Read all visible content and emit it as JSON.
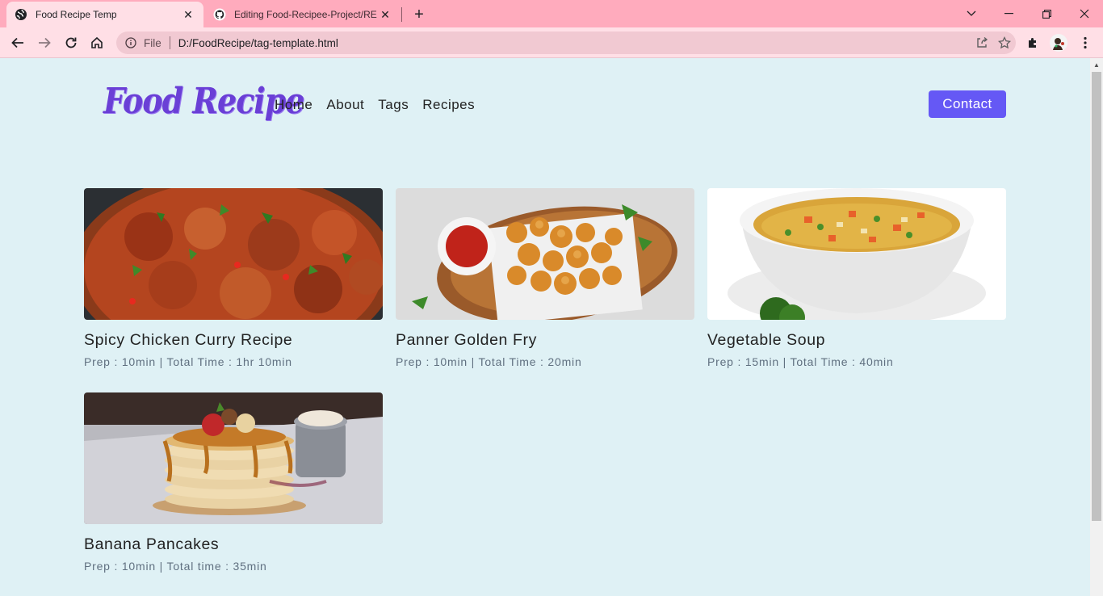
{
  "browser": {
    "tabs": [
      {
        "title": "Food Recipe Temp"
      },
      {
        "title": "Editing Food-Recipee-Project/RE"
      }
    ],
    "address": {
      "scheme": "File",
      "url": "D:/FoodRecipe/tag-template.html"
    }
  },
  "site": {
    "logo_text": "Food Recipe",
    "nav": [
      {
        "label": "Home"
      },
      {
        "label": "About"
      },
      {
        "label": "Tags"
      },
      {
        "label": "Recipes"
      }
    ],
    "contact_label": "Contact"
  },
  "recipes": [
    {
      "name": "Spicy Chicken Curry Recipe",
      "meta": "Prep : 10min | Total Time : 1hr 10min"
    },
    {
      "name": "Panner Golden Fry",
      "meta": "Prep : 10min | Total Time : 20min"
    },
    {
      "name": "Vegetable Soup",
      "meta": "Prep : 15min | Total Time : 40min"
    },
    {
      "name": "Banana Pancakes",
      "meta": "Prep : 10min | Total time : 35min"
    }
  ],
  "colors": {
    "page_bg": "#dff1f5",
    "accent": "#6558f5",
    "logo": "#6a3fd6",
    "tabbar": "#ffabbd"
  }
}
